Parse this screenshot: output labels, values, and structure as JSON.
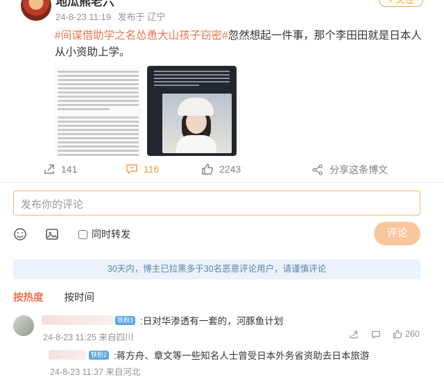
{
  "post": {
    "author": "地瓜熊老六",
    "time": "24-8-23 11:19",
    "source": "发布于 辽宁",
    "follow_label": "+ 关注",
    "topic": "#间谍借助学之名怂恿大山孩子窃密#",
    "body": "忽然想起一件事，那个李田田就是日本人从小资助上学。",
    "repost_count": "141",
    "comment_count": "116",
    "like_count": "2243",
    "share_label": "分享这条博文"
  },
  "composer": {
    "placeholder": "发布你的评论",
    "repost_label": "同时转发",
    "submit_label": "评论"
  },
  "notice": "30天内，博主已拉黑多于30名恶意评论用户，请谨慎评论",
  "sort": {
    "hot": "按热度",
    "time": "按时间"
  },
  "comments": [
    {
      "badge": "铁粉3",
      "text": ":日对华渗透有一套的，河豚鱼计划",
      "time": "24-8-23 11:25",
      "location": "来自四川",
      "likes": "260"
    },
    {
      "badge": "铁粉2",
      "text": ":蒋方舟、章文等一些知名人士曾受日本外务省资助去日本旅游",
      "time": "24-8-23 11:37",
      "location": "来自河北"
    }
  ],
  "colors": {
    "accent": "#f59a3d",
    "topic": "#eb7350",
    "notice_bg": "#eaf3fb"
  }
}
